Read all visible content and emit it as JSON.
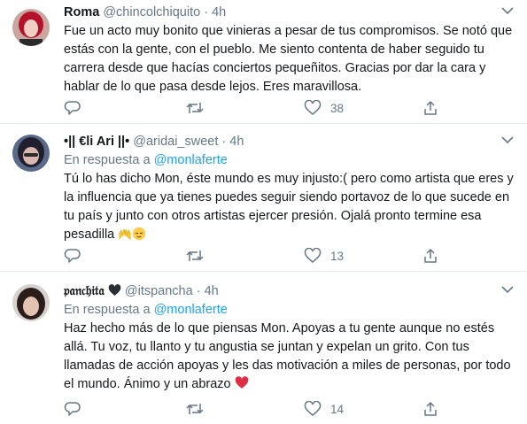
{
  "tweets": [
    {
      "name": "Roma",
      "handle": "@chincolchiquito",
      "separator": "·",
      "time": "4h",
      "reply_prefix": "",
      "reply_to": "",
      "text": "Fue un acto muy bonito que vinieras a pesar de tus compromisos. Se notó que estás con la gente, con el pueblo. Me siento contenta de haber seguido tu carrera desde que hacías conciertos pequeñitos. Gracias por dar la cara y hablar de lo que pasa desde lejos. Eres maravillosa.",
      "like_count": "38"
    },
    {
      "name": "•|| €li Ari ||•",
      "handle": "@aridai_sweet",
      "separator": "·",
      "time": "4h",
      "reply_prefix": "En respuesta a ",
      "reply_to": "@monlaferte",
      "text": "Tú lo has dicho Mon, éste mundo es muy injusto:( pero como artista que eres y la influencia que ya tienes puedes seguir siendo portavoz de lo que sucede en tu país y junto con otros artistas ejercer presión. Ojalá pronto termine esa pesadilla",
      "emojis": [
        "raising-hands",
        "relieved-face"
      ],
      "like_count": "13"
    },
    {
      "name": "𝔭𝔞𝔫𝔠𝔥𝔦𝔱𝔞",
      "name_emoji": "black-heart",
      "handle": "@itspancha",
      "separator": "·",
      "time": "4h",
      "reply_prefix": "En respuesta a ",
      "reply_to": "@monlaferte",
      "text": "Haz hecho más de lo que piensas Mon. Apoyas a tu gente aunque no estés allá. Tu voz, tu llanto y tu angustia se juntan y expelan un grito. Con tus llamadas de acción apoyas y les das motivación a miles de personas, por todo el mundo. Ánimo y un abrazo",
      "emojis": [
        "red-heart"
      ],
      "like_count": "14"
    }
  ],
  "colors": {
    "text": "#14171a",
    "secondary": "#657786",
    "link": "#1da1f2",
    "divider": "#e6ecf0",
    "heart_red": "#e0245e"
  }
}
